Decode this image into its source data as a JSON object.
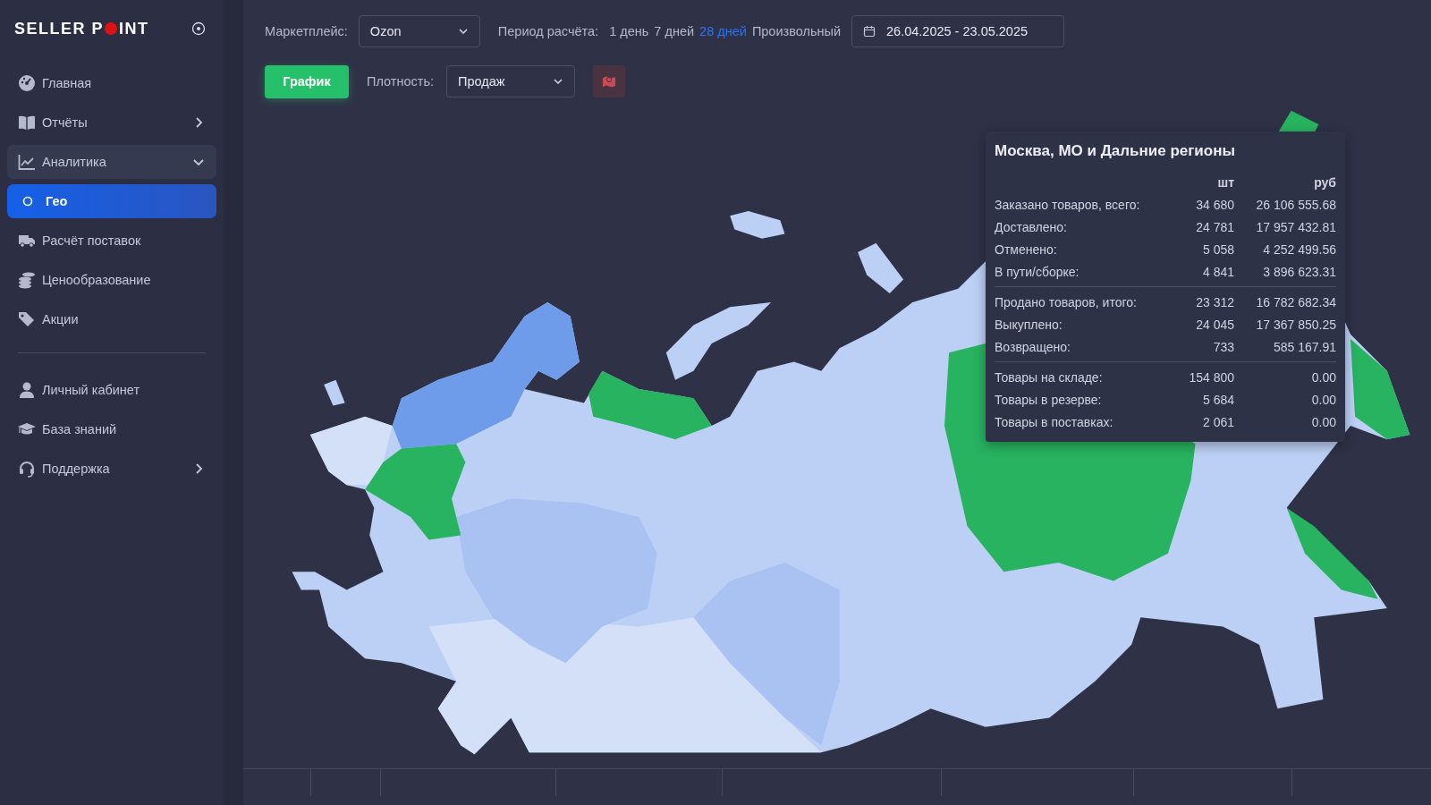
{
  "sidebar": {
    "logo": {
      "left": "SELLER P",
      "right": "INT"
    },
    "main_items": [
      {
        "label": "Главная",
        "selected": false
      },
      {
        "label": "Отчёты",
        "selected": false,
        "expanded": false
      },
      {
        "label": "Аналитика",
        "selected": false,
        "expanded": true,
        "children": [
          {
            "label": "Гео",
            "selected": true
          }
        ]
      },
      {
        "label": "Расчёт поставок",
        "selected": false
      },
      {
        "label": "Ценообразование",
        "selected": false
      },
      {
        "label": "Акции",
        "selected": false
      }
    ],
    "account_items": [
      {
        "label": "Личный кабинет",
        "selected": false
      },
      {
        "label": "База знаний",
        "selected": false
      },
      {
        "label": "Поддержка",
        "selected": false,
        "expanded": false
      }
    ]
  },
  "filters": {
    "marketplace": {
      "label": "Маркетплейс:",
      "value": "Ozon"
    },
    "period": {
      "label": "Период расчёта:",
      "options": [
        {
          "label": "1 день",
          "selected": false
        },
        {
          "label": "7 дней",
          "selected": false
        },
        {
          "label": "28 дней",
          "selected": true
        },
        {
          "label": "Произвольный",
          "selected": false
        }
      ]
    },
    "date_range": {
      "value": "26.04.2025 - 23.05.2025"
    },
    "chart_button": "График",
    "density": {
      "label": "Плотность:",
      "value": "Продаж"
    }
  },
  "tooltip": {
    "title": "Москва, МО и Дальние регионы",
    "columns": [
      "шт",
      "руб"
    ],
    "groups": [
      [
        {
          "label": "Заказано товаров, всего:",
          "qty": "34 680",
          "rub": "26 106 555.68"
        },
        {
          "label": "Доставлено:",
          "qty": "24 781",
          "rub": "17 957 432.81"
        },
        {
          "label": "Отменено:",
          "qty": "5 058",
          "rub": "4 252 499.56"
        },
        {
          "label": "В пути/сборке:",
          "qty": "4 841",
          "rub": "3 896 623.31"
        }
      ],
      [
        {
          "label": "Продано товаров, итого:",
          "qty": "23 312",
          "rub": "16 782 682.34"
        },
        {
          "label": "Выкуплено:",
          "qty": "24 045",
          "rub": "17 367 850.25"
        },
        {
          "label": "Возвращено:",
          "qty": "733",
          "rub": "585 167.91"
        }
      ],
      [
        {
          "label": "Товары на складе:",
          "qty": "154 800",
          "rub": "0.00"
        },
        {
          "label": "Товары в резерве:",
          "qty": "5 684",
          "rub": "0.00"
        },
        {
          "label": "Товары в поставках:",
          "qty": "2 061",
          "rub": "0.00"
        }
      ]
    ]
  }
}
